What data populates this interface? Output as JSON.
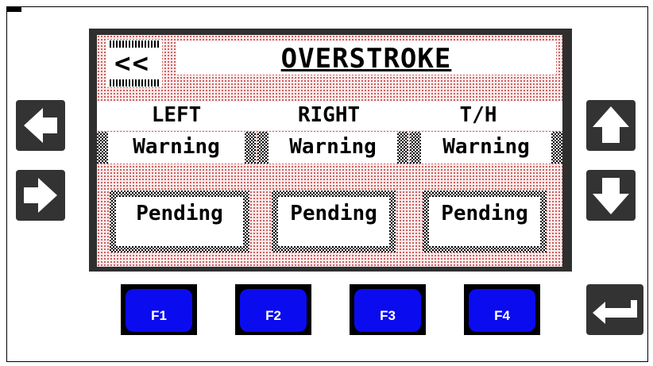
{
  "screen": {
    "back_label": "<<",
    "title": "OVERSTROKE",
    "columns": [
      {
        "label": "LEFT",
        "status": "Warning",
        "state": "Pending"
      },
      {
        "label": "RIGHT",
        "status": "Warning",
        "state": "Pending"
      },
      {
        "label": "T/H",
        "status": "Warning",
        "state": "Pending"
      }
    ]
  },
  "function_keys": [
    "F1",
    "F2",
    "F3",
    "F4"
  ],
  "icons": {
    "left": "arrow-left-icon",
    "right": "arrow-right-icon",
    "up": "arrow-up-icon",
    "down": "arrow-down-icon",
    "enter": "enter-icon"
  },
  "colors": {
    "fkey": "#0b0bf0",
    "lcd_dot": "#c44a4a",
    "lcd_bg": "#fbeaea",
    "button": "#333333"
  }
}
